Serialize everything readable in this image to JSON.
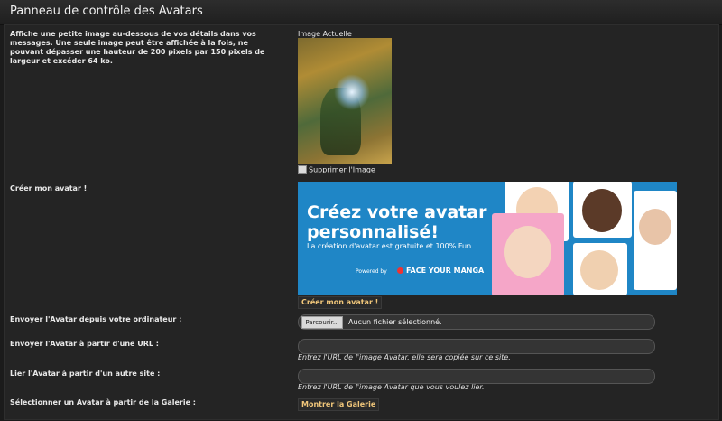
{
  "header": {
    "title": "Panneau de contrôle des Avatars"
  },
  "description": "Affiche une petite image au-dessous de vos détails dans vos messages. Une seule image peut être affichée à la fois, ne pouvant dépasser une hauteur de 200 pixels par 150 pixels de largeur et excéder 64 ko.",
  "current_image": {
    "label": "Image Actuelle",
    "delete_label": "Supprimer l'Image"
  },
  "create_avatar": {
    "label": "Créer mon avatar !",
    "banner_title": "Créez votre avatar personnalisé!",
    "banner_subtitle": "La création d'avatar est gratuite et 100% Fun",
    "banner_powered": "Powered by",
    "banner_brand": "FACE YOUR MANGA",
    "button_label": "Créer mon avatar !"
  },
  "upload": {
    "label": "Envoyer l'Avatar depuis votre ordinateur :",
    "browse_label": "Parcourir...",
    "status": "Aucun fichier sélectionné."
  },
  "url_upload": {
    "label": "Envoyer l'Avatar à partir d'une URL :",
    "value": "",
    "hint": "Entrez l'URL de l'image Avatar, elle sera copiée sur ce site."
  },
  "link_remote": {
    "label": "Lier l'Avatar à partir d'un autre site :",
    "value": "",
    "hint": "Entrez l'URL de l'image Avatar que vous voulez lier."
  },
  "gallery": {
    "label": "Sélectionner un Avatar à partir de la Galerie :",
    "button_label": "Montrer la Galerie"
  }
}
